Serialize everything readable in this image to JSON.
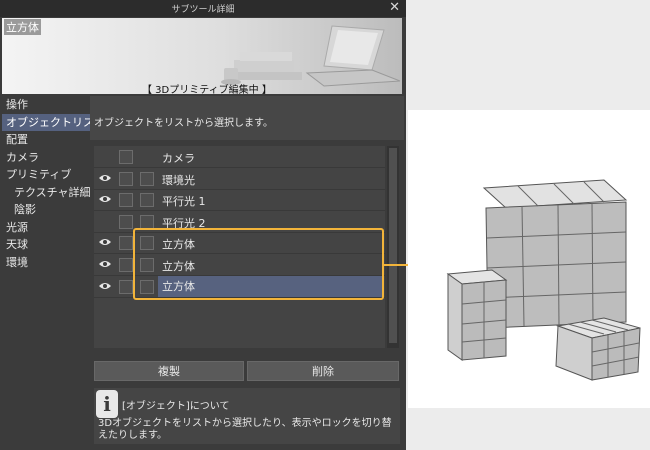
{
  "window": {
    "title": "サブツール詳細",
    "close": "✕"
  },
  "preview": {
    "title": "立方体",
    "status": "【 3Dプリミティブ編集中 】"
  },
  "sidebar": {
    "items": [
      {
        "label": "操作"
      },
      {
        "label": "オブジェクトリスト",
        "active": true
      },
      {
        "label": "配置"
      },
      {
        "label": "カメラ"
      },
      {
        "label": "プリミティブ"
      },
      {
        "label": "テクスチャ詳細",
        "sub": true
      },
      {
        "label": "陰影",
        "sub": true
      },
      {
        "label": "光源"
      },
      {
        "label": "天球"
      },
      {
        "label": "環境"
      }
    ]
  },
  "header": {
    "text": "オブジェクトをリストから選択します。"
  },
  "object_list": {
    "rows": [
      {
        "name": "カメラ",
        "eye": false,
        "eye_slot": false
      },
      {
        "name": "環境光",
        "eye": true
      },
      {
        "name": "平行光 1",
        "eye": true
      },
      {
        "name": "平行光 2",
        "eye": false
      },
      {
        "name": "立方体",
        "eye": true
      },
      {
        "name": "立方体",
        "eye": true
      },
      {
        "name": "立方体",
        "eye": true,
        "selected": true
      }
    ]
  },
  "buttons": {
    "duplicate": "複製",
    "delete": "削除"
  },
  "info": {
    "icon": "info-icon",
    "title": "[オブジェクト]について",
    "text": "3Dオブジェクトをリストから選択したり、表示やロックを切り替えたりします。"
  },
  "colors": {
    "highlight": "#f2b43a",
    "selection": "#57627f"
  }
}
